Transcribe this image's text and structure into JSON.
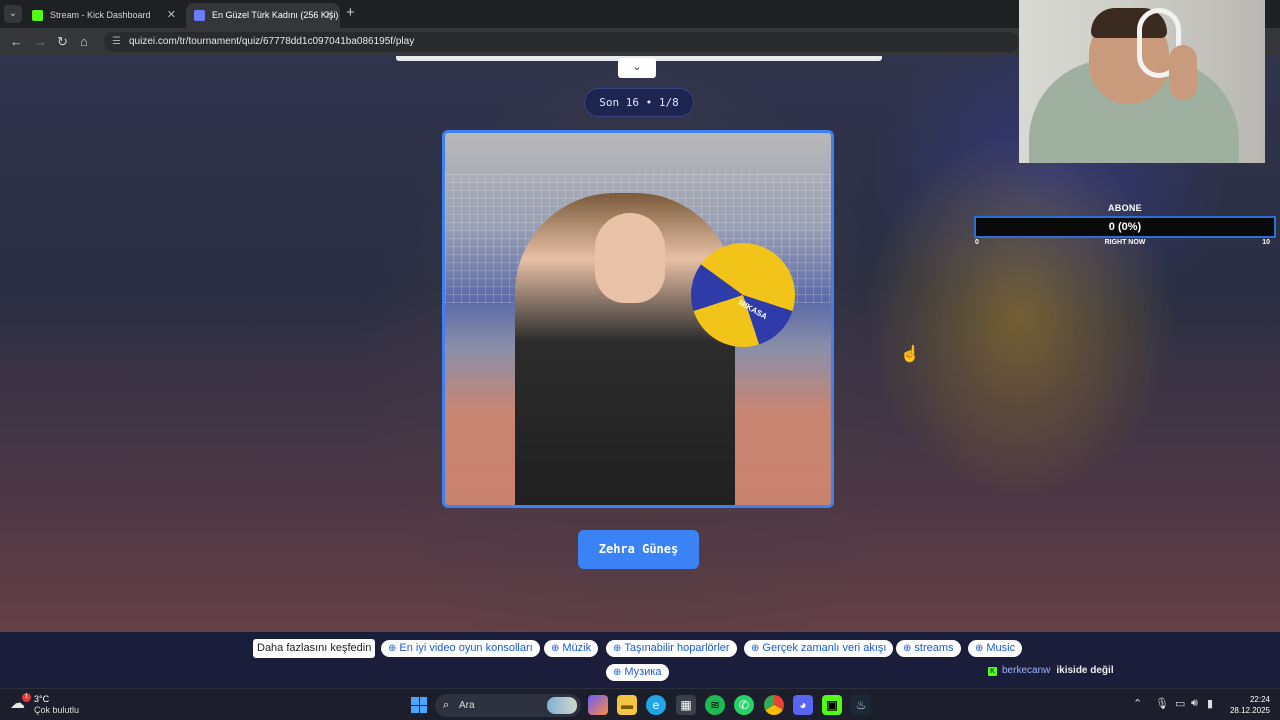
{
  "browser": {
    "tabs": [
      {
        "label": "Stream - Kick Dashboard",
        "favicon_color": "#53fc18"
      },
      {
        "label": "En Güzel Türk Kadını (256 Kişi)",
        "favicon_color": "#6a7cff"
      }
    ],
    "url": "quizei.com/tr/tournament/quiz/67778dd1c097041ba086195f/play"
  },
  "quiz": {
    "round": "Son 16 • 1/8",
    "contestant_name": "Zehra Güneş",
    "photo_ball_brand": "MIKASA"
  },
  "sub_goal": {
    "title": "ABONE",
    "value": "0 (0%)",
    "min": "0",
    "mid": "RIGHT NOW",
    "max": "10",
    "progress": 0
  },
  "ads": {
    "label": "Daha fazlasını keşfedin",
    "chips": [
      "En iyi video oyun konsolları",
      "Müzik",
      "Taşınabilir hoparlörler",
      "Gerçek zamanlı veri akışı",
      "streams",
      "Music",
      "Музика"
    ]
  },
  "chat": {
    "username": "berkecanw",
    "message": "ikiside değil"
  },
  "taskbar": {
    "weather_temp": "3°C",
    "weather_desc": "Çok bulutlu",
    "weather_badge": "1",
    "search_placeholder": "Ara",
    "time": "22:24",
    "date": "28.12.2025"
  },
  "colors": {
    "accent": "#3b82f6",
    "kick_green": "#53fc18",
    "round_pill_bg": "#1e2450"
  }
}
